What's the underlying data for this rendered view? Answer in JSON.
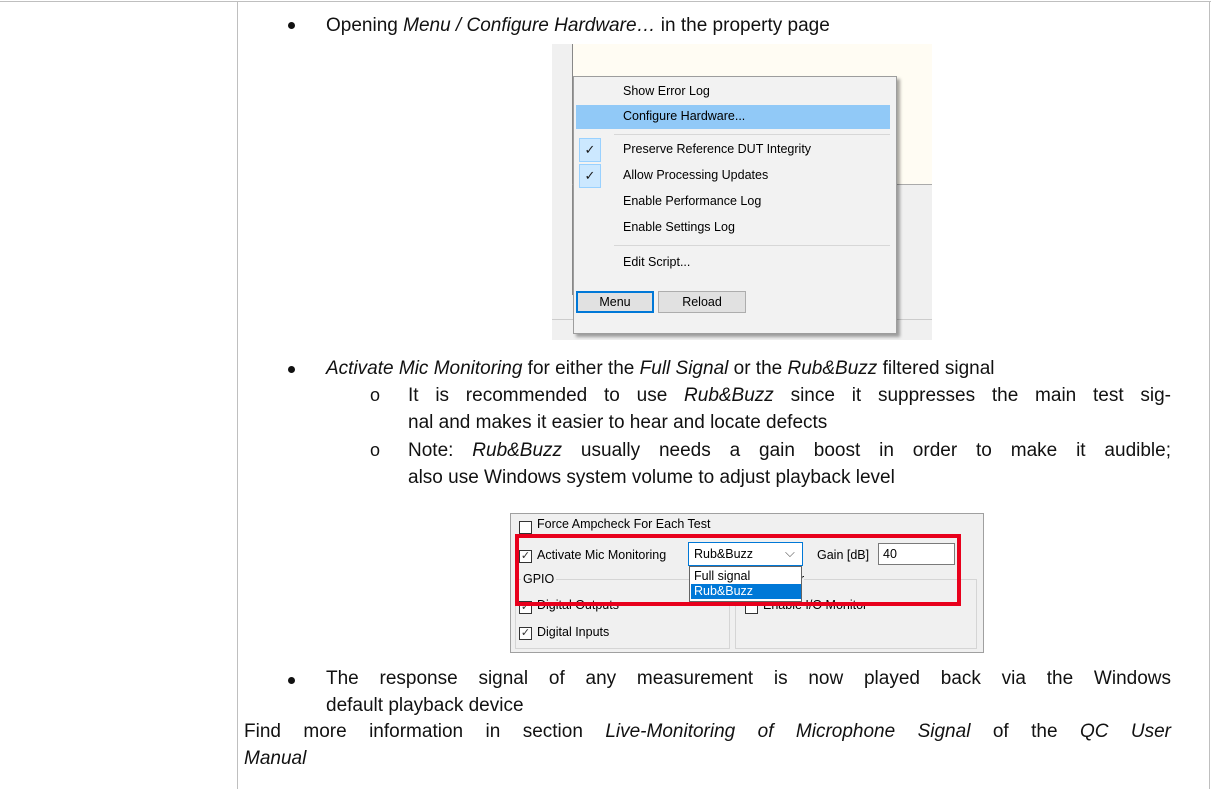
{
  "bullets": {
    "b1": {
      "prefix": "Opening ",
      "italic": "Menu / Configure Hardware…",
      "suffix": " in the property page"
    },
    "b2": {
      "italic1": "Activate Mic Monitoring",
      "mid": " for either the ",
      "italic2": "Full Signal",
      "mid2": " or the ",
      "italic3": "Rub&Buzz",
      "suffix": " filtered signal"
    },
    "sub1": {
      "prefix": "It is recommended to use ",
      "italic": "Rub&Buzz",
      "line1_rest": " since it suppresses the main test sig-",
      "line2": "nal and makes it easier to hear and locate defects"
    },
    "sub2": {
      "prefix": "Note: ",
      "italic": "Rub&Buzz",
      "line1_rest": " usually needs a gain boost in order to make it audible;",
      "line2": "also use Windows system volume to adjust playback level"
    },
    "b3": {
      "line1": "The response signal of any measurement is now played back via the Windows",
      "line2": "default playback device"
    },
    "sub_marker": "o",
    "footer": {
      "prefix": "Find more information in section ",
      "italic1": "Live-Monitoring of Microphone Signal",
      "mid": " of the ",
      "italic2": "QC User",
      "line2": "Manual"
    }
  },
  "context_menu": {
    "items": [
      {
        "label": "Show Error Log",
        "checked": false,
        "highlighted": false
      },
      {
        "label": "Configure Hardware...",
        "checked": false,
        "highlighted": true
      },
      {
        "label": "Preserve Reference DUT Integrity",
        "checked": true,
        "highlighted": false
      },
      {
        "label": "Allow Processing Updates",
        "checked": true,
        "highlighted": false
      },
      {
        "label": "Enable Performance Log",
        "checked": false,
        "highlighted": false
      },
      {
        "label": "Enable Settings Log",
        "checked": false,
        "highlighted": false
      },
      {
        "label": "Edit Script...",
        "checked": false,
        "highlighted": false
      }
    ],
    "check_glyph": "✓",
    "buttons": {
      "menu": "Menu",
      "reload": "Reload"
    }
  },
  "settings_panel": {
    "force_ampcheck": {
      "label": "Force Ampcheck For Each Test",
      "checked": false
    },
    "activate_mic": {
      "label": "Activate Mic Monitoring",
      "checked": true
    },
    "mode_select": {
      "value": "Rub&Buzz",
      "options": [
        "Full signal",
        "Rub&Buzz"
      ],
      "selected_option": "Rub&Buzz"
    },
    "gain": {
      "label": "Gain [dB]",
      "value": "40"
    },
    "gpio_group": "GPIO",
    "monitor_group_tail": "or",
    "digital_outputs": {
      "label": "Digital Outputs",
      "checked": true
    },
    "enable_io_monitor": {
      "label": "Enable I/O Monitor",
      "checked": false
    },
    "digital_inputs": {
      "label": "Digital Inputs",
      "checked": true
    },
    "check_glyph": "✓",
    "highlight_color": "#e8001c"
  },
  "colors": {
    "menu_highlight": "#91c9f7",
    "dropdown_selected": "#0078d7",
    "focus_border": "#0078d7"
  }
}
